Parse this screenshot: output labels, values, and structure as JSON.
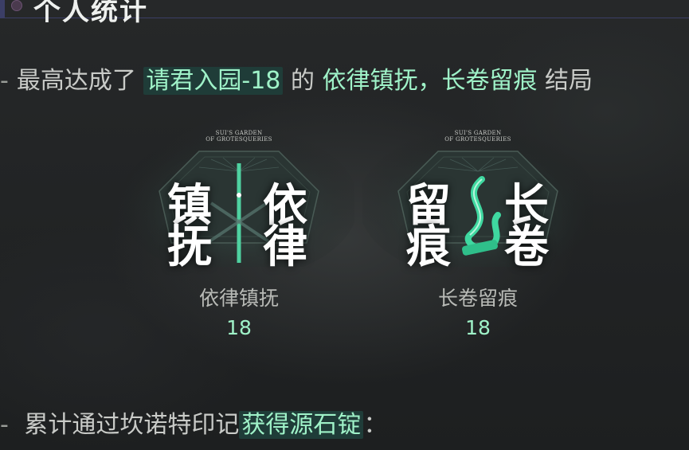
{
  "header": {
    "title": "个人统计"
  },
  "summary": {
    "dash": "-",
    "prefix": "最高达成了",
    "stage": "请君入园-18",
    "middle": "的",
    "ending1": "依律镇抚，长卷留痕",
    "suffix": "结局"
  },
  "badges": [
    {
      "brand_line1": "SUI'S GARDEN",
      "brand_line2": "OF GROTESQUERIES",
      "chars": [
        "镇",
        "抚",
        "依",
        "律"
      ],
      "name": "依律镇抚",
      "count": "18"
    },
    {
      "brand_line1": "SUI'S GARDEN",
      "brand_line2": "OF GROTESQUERIES",
      "chars": [
        "留",
        "痕",
        "长",
        "卷"
      ],
      "name": "长卷留痕",
      "count": "18"
    }
  ],
  "footer_line": {
    "dash": "-",
    "prefix": "累计通过坎诺特印记",
    "highlight": "获得源石锭",
    "suffix": "："
  },
  "colors": {
    "accent": "#9ff2c8",
    "highlight_bg": "#1f3c38",
    "header_rule": "#3b3e66"
  }
}
